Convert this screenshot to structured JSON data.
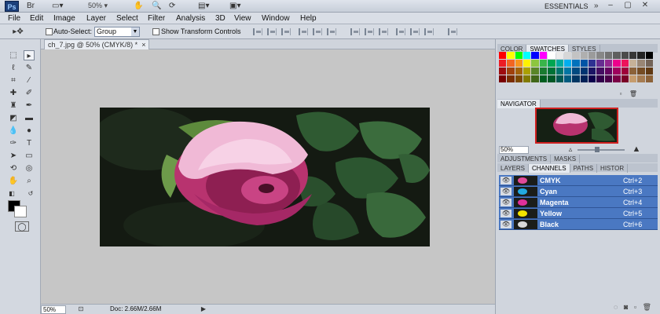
{
  "appbar": {
    "logo": "Ps",
    "zoom": "50%",
    "workspace": "ESSENTIALS",
    "window_controls": [
      "–",
      "▢",
      "✕"
    ]
  },
  "menu": {
    "items": [
      "File",
      "Edit",
      "Image",
      "Layer",
      "Select",
      "Filter",
      "Analysis",
      "3D",
      "View",
      "Window",
      "Help"
    ]
  },
  "options": {
    "auto_select_label": "Auto-Select:",
    "auto_select_value": "Group",
    "show_transform_label": "Show Transform Controls"
  },
  "document": {
    "tab_title": "ch_7.jpg @ 50% (CMYK/8) *",
    "tab_close": "×"
  },
  "status": {
    "zoom": "50%",
    "doc": "Doc: 2.66M/2.66M"
  },
  "panels": {
    "top_tabs": [
      "COLOR",
      "SWATCHES",
      "STYLES"
    ],
    "navigator_tab": "NAVIGATOR",
    "navigator_zoom": "50%",
    "adjust_tabs": [
      "ADJUSTMENTS",
      "MASKS"
    ],
    "channel_tabs": [
      "LAYERS",
      "CHANNELS",
      "PATHS",
      "HISTOR"
    ],
    "channels": [
      {
        "name": "CMYK",
        "shortcut": "Ctrl+2",
        "color": "#e24b9a"
      },
      {
        "name": "Cyan",
        "shortcut": "Ctrl+3",
        "color": "#23a9e1"
      },
      {
        "name": "Magenta",
        "shortcut": "Ctrl+4",
        "color": "#e0309a"
      },
      {
        "name": "Yellow",
        "shortcut": "Ctrl+5",
        "color": "#f2e300"
      },
      {
        "name": "Black",
        "shortcut": "Ctrl+6",
        "color": "#d8d8d8"
      }
    ]
  },
  "swatch_colors": [
    "#ff0000",
    "#ffff00",
    "#00ff00",
    "#00ffff",
    "#0000ff",
    "#ff00ff",
    "#ffffff",
    "#ebebeb",
    "#d7d7d7",
    "#c3c3c3",
    "#afafaf",
    "#9b9b9b",
    "#878787",
    "#737373",
    "#5f5f5f",
    "#4b4b4b",
    "#373737",
    "#232323",
    "#000000",
    "#ed1c24",
    "#f26522",
    "#f7941d",
    "#fff200",
    "#8dc63f",
    "#39b54a",
    "#00a651",
    "#00a99d",
    "#00aeef",
    "#0072bc",
    "#0054a6",
    "#2e3192",
    "#662d91",
    "#92278f",
    "#ec008c",
    "#ed145b",
    "#c6b198",
    "#998675",
    "#736357",
    "#9e0b0f",
    "#a0410d",
    "#a36209",
    "#aba000",
    "#598527",
    "#197b30",
    "#007236",
    "#00746b",
    "#0076a3",
    "#004a80",
    "#003471",
    "#1b1464",
    "#440e62",
    "#630460",
    "#9e005d",
    "#9e0039",
    "#8c6239",
    "#754c24",
    "#603913",
    "#790000",
    "#7b2e00",
    "#7d4900",
    "#827b00",
    "#406618",
    "#005e20",
    "#005826",
    "#005952",
    "#005b7f",
    "#003663",
    "#002157",
    "#0d004c",
    "#32004b",
    "#4b0049",
    "#7b0046",
    "#7a0026",
    "#c69c6d",
    "#a67c52",
    "#8c6239"
  ],
  "colors": {
    "accent_selected": "#4a78c2",
    "canvas_bg": "#c6c6c6",
    "foreground": "#000000",
    "background": "#ffffff"
  }
}
